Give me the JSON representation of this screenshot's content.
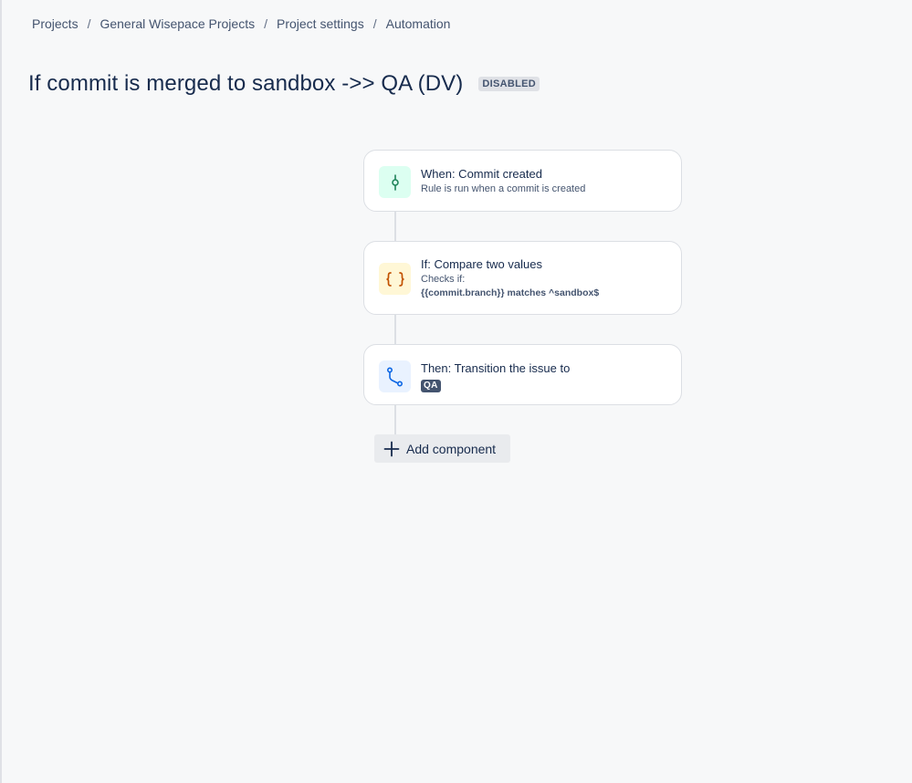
{
  "breadcrumb": {
    "items": [
      "Projects",
      "General Wisepace Projects",
      "Project settings",
      "Automation"
    ],
    "separator": "/"
  },
  "rule": {
    "title": "If commit is merged to sandbox ->> QA (DV)",
    "status": "DISABLED"
  },
  "components": [
    {
      "kind": "trigger",
      "icon": "commit-icon",
      "title": "When: Commit created",
      "subtitle": "Rule is run when a commit is created"
    },
    {
      "kind": "condition",
      "icon": "braces-icon",
      "title": "If: Compare two values",
      "subtitle": "Checks if:",
      "code": "{{commit.branch}} matches ^sandbox$"
    },
    {
      "kind": "action",
      "icon": "transition-icon",
      "title": "Then: Transition the issue to",
      "lozenge": "QA"
    }
  ],
  "add_component": {
    "label": "Add component",
    "icon": "plus-icon"
  },
  "colors": {
    "trigger_bg": "#dcfff1",
    "trigger_fg": "#1f845a",
    "condition_bg": "#fff7d6",
    "condition_fg": "#c25100",
    "action_bg": "#e9f2ff",
    "action_fg": "#0c66e4"
  }
}
